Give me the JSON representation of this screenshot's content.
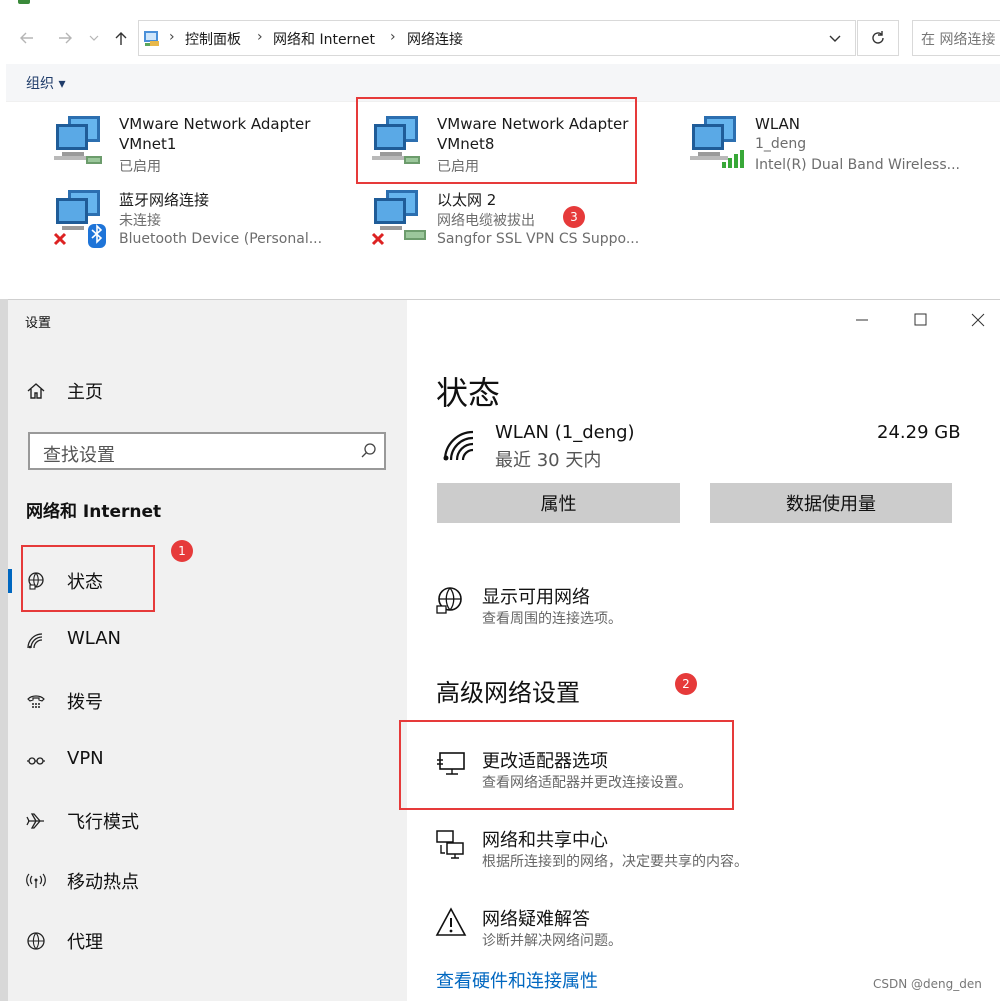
{
  "explorer": {
    "breadcrumb": [
      "控制面板",
      "网络和 Internet",
      "网络连接"
    ],
    "search_placeholder": "在 网络连接",
    "toolbar": {
      "organize_label": "组织 ▾"
    },
    "adapters": [
      {
        "name": "VMware Network Adapter",
        "line2": "VMnet1",
        "line3": "已启用"
      },
      {
        "name": "VMware Network Adapter",
        "line2": "VMnet8",
        "line3": "已启用"
      },
      {
        "name": "WLAN",
        "line2": "1_deng",
        "line3": "Intel(R) Dual Band Wireless..."
      },
      {
        "name": "蓝牙网络连接",
        "line2": "未连接",
        "line3": "Bluetooth Device (Personal..."
      },
      {
        "name": "以太网 2",
        "line2": "网络电缆被拔出",
        "line3": "Sangfor SSL VPN CS Suppo..."
      }
    ]
  },
  "settings": {
    "window_title": "设置",
    "home": "主页",
    "search_placeholder": "查找设置",
    "section_title": "网络和 Internet",
    "nav": [
      "状态",
      "WLAN",
      "拨号",
      "VPN",
      "飞行模式",
      "移动热点",
      "代理"
    ],
    "page_title": "状态",
    "network": {
      "name": "WLAN (1_deng)",
      "period": "最近 30 天内",
      "usage": "24.29 GB"
    },
    "buttons": {
      "properties": "属性",
      "data_usage": "数据使用量"
    },
    "show_networks": {
      "title": "显示可用网络",
      "sub": "查看周围的连接选项。"
    },
    "advanced_title": "高级网络设置",
    "adapter_options": {
      "title": "更改适配器选项",
      "sub": "查看网络适配器并更改连接设置。"
    },
    "sharing_center": {
      "title": "网络和共享中心",
      "sub": "根据所连接到的网络，决定要共享的内容。"
    },
    "troubleshoot": {
      "title": "网络疑难解答",
      "sub": "诊断并解决网络问题。"
    },
    "hardware_link": "查看硬件和连接属性"
  },
  "annotations": {
    "badge1": "1",
    "badge2": "2",
    "badge3": "3"
  },
  "watermark": "CSDN @deng_den",
  "colors": {
    "accent": "#0067c0",
    "annotation_red": "#e63a3a",
    "sidebar_bg": "#f1f1f1",
    "button_bg": "#cccccc"
  }
}
